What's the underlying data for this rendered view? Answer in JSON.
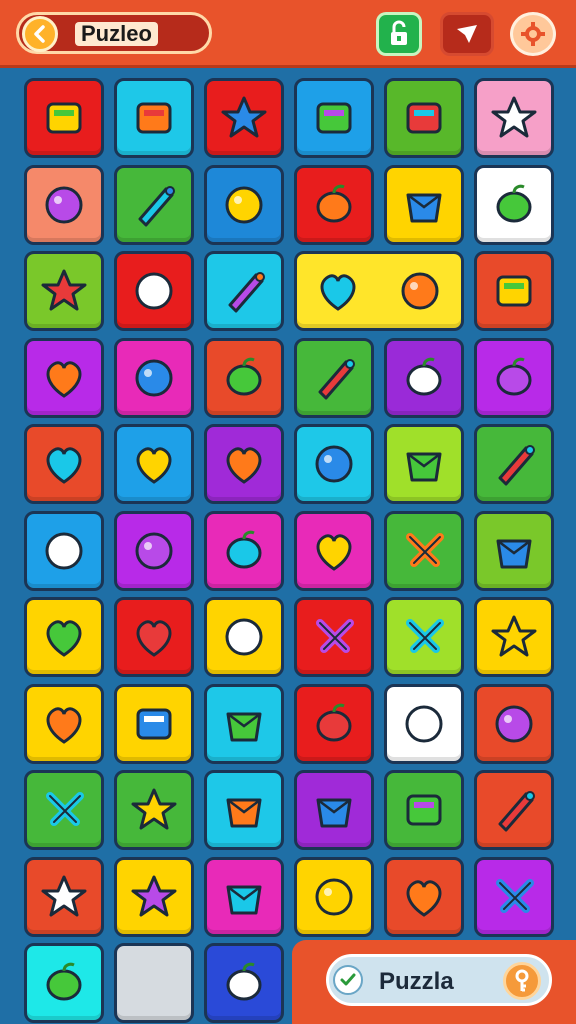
{
  "header": {
    "title": "Puzleo",
    "back_icon": "chevron-left-icon",
    "buttons": [
      {
        "name": "lock-button",
        "icon": "unlock-icon",
        "color": "#22b24c"
      },
      {
        "name": "shape-button",
        "icon": "arrow-shape-icon",
        "color": "#b62b1b"
      },
      {
        "name": "settings-button",
        "icon": "gear-icon",
        "color": "#ffc89a"
      }
    ]
  },
  "tiles": [
    {
      "icon": "sun-icon",
      "bg": "#e81d1d"
    },
    {
      "icon": "smiling-sun-icon",
      "bg": "#1ec8e8"
    },
    {
      "icon": "pencil-icon",
      "bg": "#e81d1d"
    },
    {
      "icon": "flag-icon",
      "bg": "#1ea0e8"
    },
    {
      "icon": "rocket-icon",
      "bg": "#58b82a"
    },
    {
      "icon": "suitcase-icon",
      "bg": "#f6a0c8"
    },
    {
      "icon": "compass-arrow-icon",
      "bg": "#f5896a"
    },
    {
      "icon": "pineapple-icon",
      "bg": "#46b83a"
    },
    {
      "icon": "clock-icon",
      "bg": "#1e88d8"
    },
    {
      "icon": "pill-icon",
      "bg": "#e81d1d"
    },
    {
      "icon": "ring-icon",
      "bg": "#ffd400"
    },
    {
      "icon": "leaf-stick-icon",
      "bg": "#ffffff"
    },
    {
      "icon": "cloud-icon",
      "bg": "#7ac82a"
    },
    {
      "icon": "blue-flower-icon",
      "bg": "#e81d1d"
    },
    {
      "icon": "spiky-ball-icon",
      "bg": "#1ec8e8"
    },
    {
      "icon": "ice-cream-tree-icon",
      "bg": "#ffe52a",
      "wide": true
    },
    {
      "icon": "loop-icon",
      "bg": "#e84a2a"
    },
    {
      "icon": "red-ball-icon",
      "bg": "#b82ae8"
    },
    {
      "icon": "basket-icon",
      "bg": "#e82ab8"
    },
    {
      "icon": "star-sun-icon",
      "bg": "#e84a2a"
    },
    {
      "icon": "apple-icon",
      "bg": "#46b83a"
    },
    {
      "icon": "crossed-sticks-icon",
      "bg": "#9a2ad8"
    },
    {
      "icon": "radish-icon",
      "bg": "#b82ae8"
    },
    {
      "icon": "cone-icon",
      "bg": "#e84a2a"
    },
    {
      "icon": "pomegranate-icon",
      "bg": "#1ea0e8"
    },
    {
      "icon": "lollipop-icon",
      "bg": "#a02ad8"
    },
    {
      "icon": "orange-icon",
      "bg": "#1ec8e8"
    },
    {
      "icon": "envelope-icon",
      "bg": "#a0e02a"
    },
    {
      "icon": "paddle-icon",
      "bg": "#46b83a"
    },
    {
      "icon": "magnifier-icon",
      "bg": "#1ea0e8"
    },
    {
      "icon": "bottle-icon",
      "bg": "#b82ae8"
    },
    {
      "icon": "beach-ball-icon",
      "bg": "#e82ab8"
    },
    {
      "icon": "jar-icon",
      "bg": "#e82ab8"
    },
    {
      "icon": "gem-icon",
      "bg": "#46b83a"
    },
    {
      "icon": "arrow-right-icon",
      "bg": "#7ac82a"
    },
    {
      "icon": "candy-jar-icon",
      "bg": "#ffd400"
    },
    {
      "icon": "blue-heart-icon",
      "bg": "#e81d1d"
    },
    {
      "icon": "cup-icon",
      "bg": "#ffd400"
    },
    {
      "icon": "swirl-icon",
      "bg": "#e81d1d"
    },
    {
      "icon": "ghost-icon",
      "bg": "#a0e02a"
    },
    {
      "icon": "heart-leaf-icon",
      "bg": "#ffd400"
    },
    {
      "icon": "lemon-icon",
      "bg": "#ffd400"
    },
    {
      "icon": "plum-icon",
      "bg": "#ffd400"
    },
    {
      "icon": "card-icon",
      "bg": "#1ec8e8"
    },
    {
      "icon": "bright-sun-icon",
      "bg": "#e81d1d"
    },
    {
      "icon": "star-flower-icon",
      "bg": "#ffffff"
    },
    {
      "icon": "drop-ring-icon",
      "bg": "#e84a2a"
    },
    {
      "icon": "kite-icon",
      "bg": "#46b83a"
    },
    {
      "icon": "lime-icon",
      "bg": "#46b83a"
    },
    {
      "icon": "mushroom-icon",
      "bg": "#1ec8e8"
    },
    {
      "icon": "green-apple-icon",
      "bg": "#a02ad8"
    },
    {
      "icon": "bowling-ball-icon",
      "bg": "#46b83a"
    },
    {
      "icon": "star-icon",
      "bg": "#e84a2a"
    },
    {
      "icon": "face-icon",
      "bg": "#e84a2a"
    },
    {
      "icon": "lipstick-icon",
      "bg": "#ffd400"
    },
    {
      "icon": "cross-sticks-icon",
      "bg": "#e82ab8"
    },
    {
      "icon": "icecone-icon",
      "bg": "#ffd400"
    },
    {
      "icon": "meat-icon",
      "bg": "#e84a2a"
    },
    {
      "icon": "folded-paper-icon",
      "bg": "#b82ae8"
    },
    {
      "icon": "corner-arrow-icon",
      "bg": "#1ee8e8"
    },
    {
      "icon": "blank-tile-icon",
      "bg": "#d6dbe0"
    },
    {
      "icon": "spoon-globe-icon",
      "bg": "#2a4ad8"
    }
  ],
  "bottom": {
    "label": "Puzzla",
    "check_icon": "check-icon",
    "key_icon": "key-icon"
  }
}
